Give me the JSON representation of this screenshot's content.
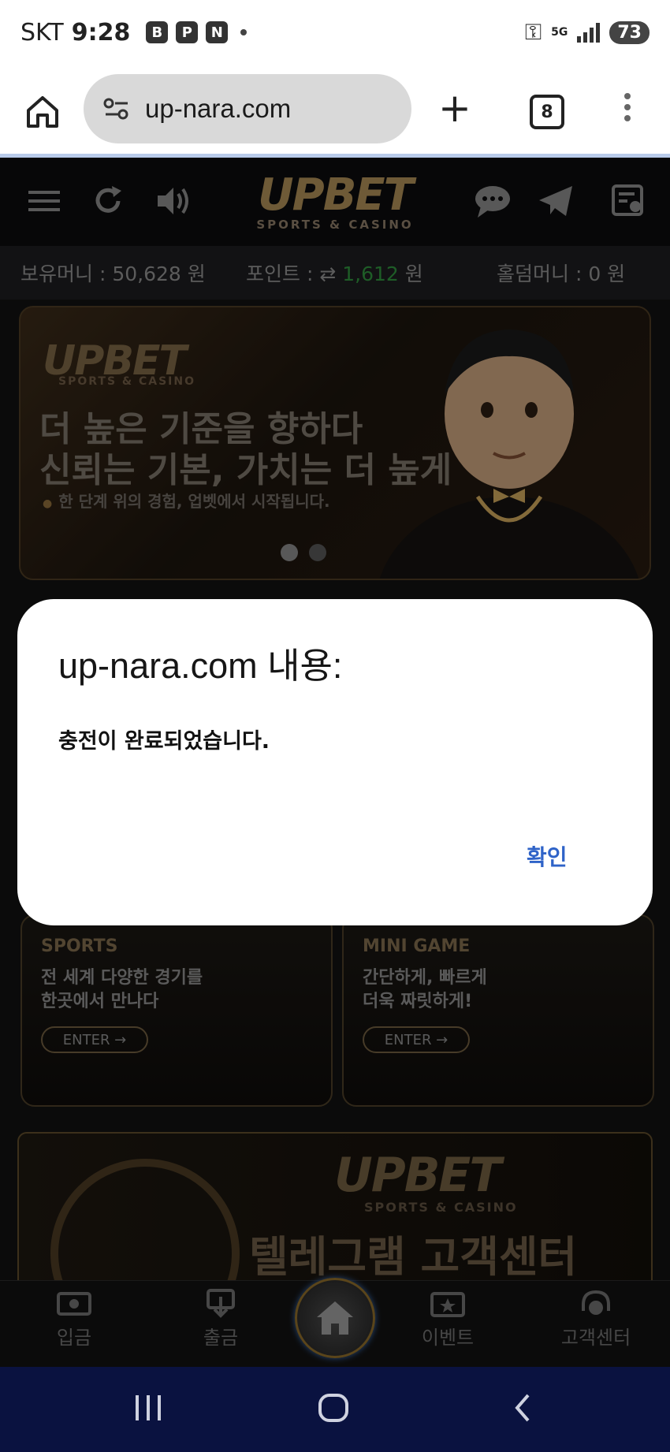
{
  "status_bar": {
    "carrier": "SKT",
    "time": "9:28",
    "app_badges": [
      "B",
      "P",
      "N"
    ],
    "network": "5G",
    "battery": "73"
  },
  "browser": {
    "url": "up-nara.com",
    "tab_count": "8"
  },
  "site": {
    "logo": "UPBET",
    "logo_sub": "SPORTS & CASINO",
    "balance_label": "보유머니 : 50,628 원",
    "points_label": "포인트 : ",
    "points_value": "1,612",
    "points_unit": " 원",
    "holdem_label": "홀덤머니 : 0 원",
    "banner": {
      "logo": "UPBET",
      "logo_sub": "SPORTS & CASINO",
      "headline1": "더 높은 기준을 향하다",
      "headline2": "신뢰는 기본, 가치는 더 높게",
      "description": "한 단계 위의 경험, 업벳에서 시작됩니다."
    },
    "cards": [
      {
        "title": "SPORTS",
        "desc1": "전 세계 다양한 경기를",
        "desc2": "한곳에서 만나다",
        "button": "ENTER →"
      },
      {
        "title": "MINI GAME",
        "desc1": "간단하게, 빠르게",
        "desc2": "더욱 짜릿하게!",
        "button": "ENTER →"
      }
    ],
    "telegram": {
      "logo": "UPBET",
      "logo_sub": "SPORTS & CASINO",
      "title": "텔레그램 고객센터"
    },
    "nav": {
      "deposit": "입금",
      "withdraw": "출금",
      "event": "이벤트",
      "support": "고객센터"
    }
  },
  "dialog": {
    "title": "up-nara.com 내용:",
    "message": "충전이 완료되었습니다.",
    "ok": "확인"
  },
  "colors": {
    "dialog_ok": "#2f63c8",
    "points_value": "#2f8f3c",
    "logo_gold": "#a98a55",
    "system_nav": "#0a1240"
  }
}
